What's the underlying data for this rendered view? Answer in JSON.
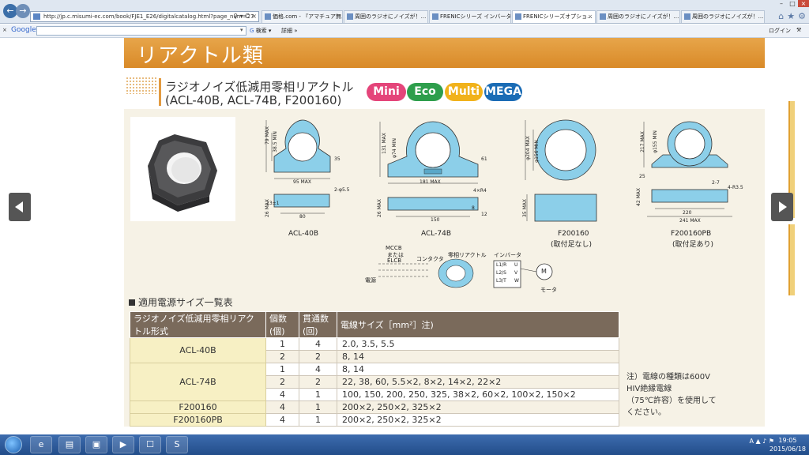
{
  "browser": {
    "url": "http://jp.c.misumi-ec.com/book/FJE1_E26/digitalcatalog.html?page_num=27",
    "tabs": [
      {
        "label": "価格.com - 『アマチュア無..."
      },
      {
        "label": "周囲のラジオにノイズが！..."
      },
      {
        "label": "FRENICシリーズ インバータ..."
      },
      {
        "label": "FRENICシリーズオプショ..."
      },
      {
        "label": "周囲のラジオにノイズが！..."
      },
      {
        "label": "周囲のラジオにノイズが！..."
      }
    ],
    "google": {
      "logo": "Google",
      "search_label": "検索",
      "detail_label": "詳細",
      "login_label": "ログイン"
    }
  },
  "page": {
    "banner_title": "リアクトル類",
    "heading_line1": "ラジオノイズ低減用零相リアクトル",
    "heading_line2": "(ACL-40B, ACL-74B, F200160)",
    "badges": [
      {
        "label": "Mini",
        "color": "#e4457a"
      },
      {
        "label": "Eco",
        "color": "#2e9e4c"
      },
      {
        "label": "Multi",
        "color": "#f1b21b"
      },
      {
        "label": "MEGA",
        "color": "#1b6cb5"
      }
    ],
    "drawings": [
      {
        "label": "ACL-40B",
        "dims": [
          "79 MAX",
          "38.5 MIN",
          "95 MAX",
          "80",
          "26 MAX",
          "13±1",
          "2-φ5.5",
          "35"
        ]
      },
      {
        "label": "ACL-74B",
        "dims": [
          "131 MAX",
          "φ74 MIN",
          "181 MAX",
          "150",
          "26 MAX",
          "4×R4",
          "61",
          "12",
          "8"
        ]
      },
      {
        "label": "F200160",
        "label2": "(取付足なし)",
        "dims": [
          "φ204 MAX",
          "φ156 MIN",
          "35 MAX"
        ]
      },
      {
        "label": "F200160PB",
        "label2": "(取付足あり)",
        "dims": [
          "217 MAX",
          "φ155 MIN",
          "220",
          "241 MAX",
          "42 MAX",
          "2-7",
          "4-R3.5",
          "25"
        ]
      }
    ],
    "wiring": {
      "mccb": "MCCB",
      "or": "または",
      "elcb": "ELCB",
      "contactor": "コンタクタ",
      "reactor": "零相リアクトル",
      "inverter": "インバータ",
      "source": "電源",
      "motor": "モータ",
      "motor_symbol": "M",
      "terminals_in": [
        "L1/R",
        "L2/S",
        "L3/T"
      ],
      "terminals_out": [
        "U",
        "V",
        "W"
      ]
    },
    "section_title": "適用電源サイズ一覧表",
    "table": {
      "headers": [
        "ラジオノイズ低減用零相リアクトル形式",
        "個数(個)",
        "貫通数(回)",
        "電線サイズ［mm²］注)"
      ],
      "rows": [
        {
          "model": "ACL-40B",
          "qty": "1",
          "turns": "4",
          "wire": "2.0, 3.5, 5.5"
        },
        {
          "model": "",
          "qty": "2",
          "turns": "2",
          "wire": "8, 14"
        },
        {
          "model": "ACL-74B",
          "qty": "1",
          "turns": "4",
          "wire": "8, 14"
        },
        {
          "model": "",
          "qty": "2",
          "turns": "2",
          "wire": "22, 38, 60, 5.5×2, 8×2, 14×2, 22×2"
        },
        {
          "model": "",
          "qty": "4",
          "turns": "1",
          "wire": "100, 150, 200, 250, 325, 38×2, 60×2, 100×2, 150×2"
        },
        {
          "model": "F200160",
          "qty": "4",
          "turns": "1",
          "wire": "200×2, 250×2, 325×2"
        },
        {
          "model": "F200160PB",
          "qty": "4",
          "turns": "1",
          "wire": "200×2, 250×2, 325×2"
        }
      ]
    },
    "note_lines": [
      "注）電線の種類は600V",
      "HIV絶縁電線",
      "（75℃許容）を使用して",
      "ください。"
    ]
  },
  "taskbar": {
    "time": "19:05",
    "date": "2015/06/18"
  }
}
